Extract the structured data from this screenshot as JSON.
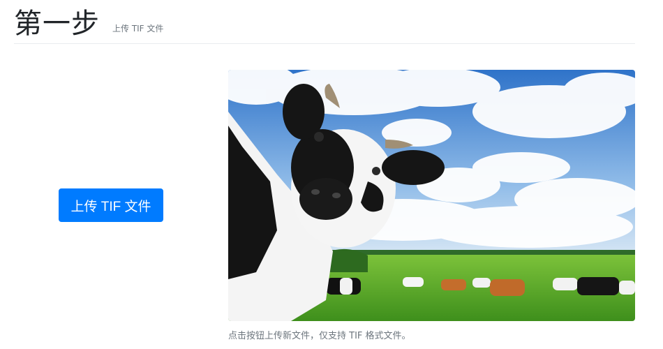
{
  "header": {
    "title": "第一步",
    "subtitle": "上传 TIF 文件"
  },
  "upload": {
    "button_label": "上传 TIF 文件"
  },
  "preview": {
    "caption": "点击按钮上传新文件，仅支持 TIF 格式文件。"
  },
  "colors": {
    "primary": "#007bff",
    "muted": "#6c757d",
    "sky": "#4d8fd6",
    "grass": "#5fae2e"
  }
}
